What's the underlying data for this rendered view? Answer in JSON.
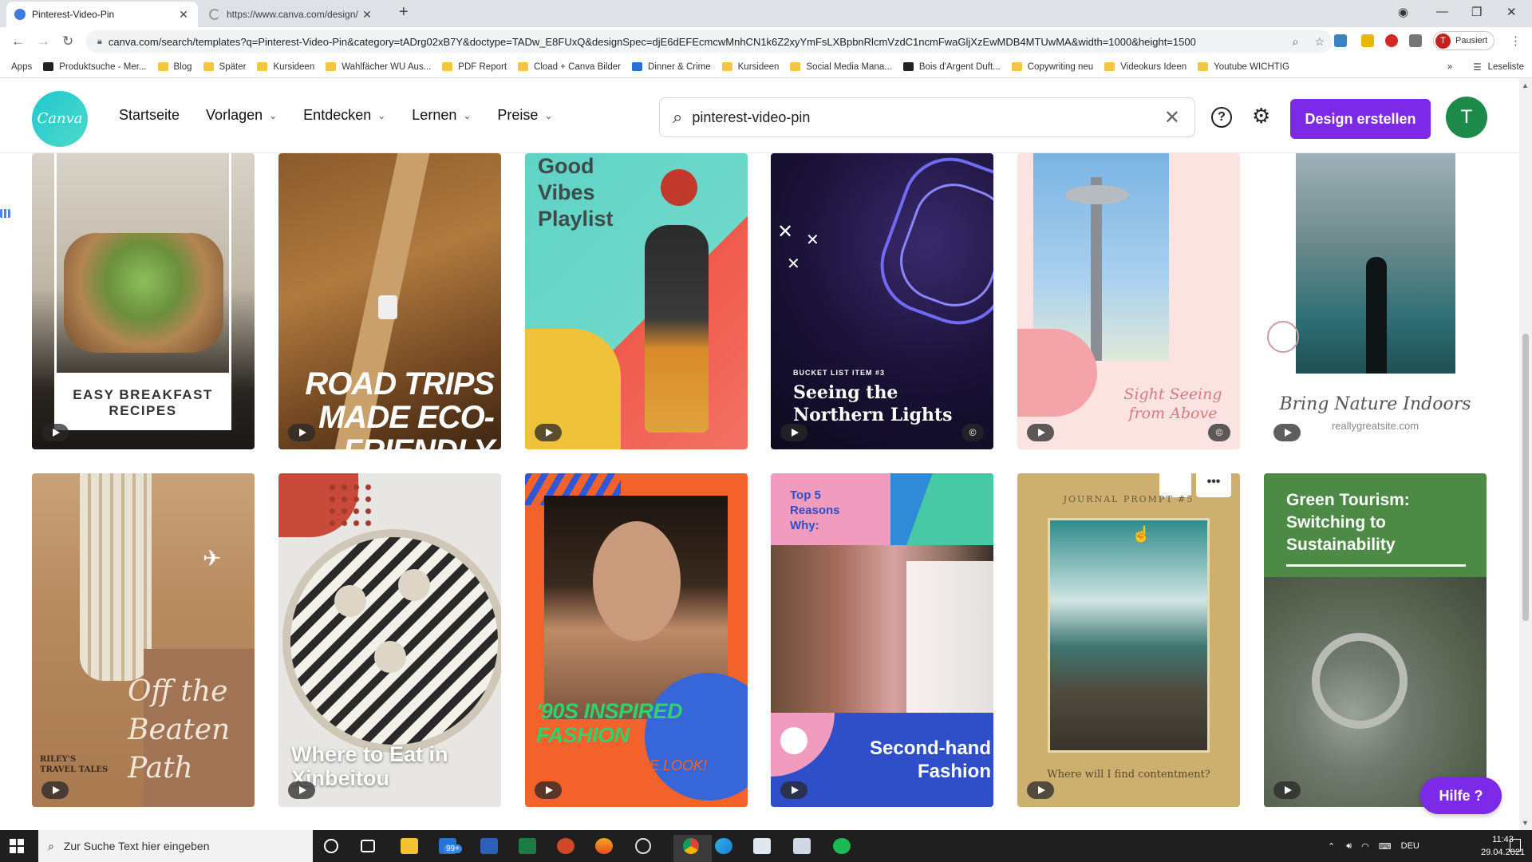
{
  "browser": {
    "tabs": [
      {
        "title": "Pinterest-Video-Pin",
        "active": true
      },
      {
        "title": "https://www.canva.com/design/",
        "active": false
      }
    ],
    "new_tab_icon": "plus-icon",
    "url": "canva.com/search/templates?q=Pinterest-Video-Pin&category=tADrg02xB7Y&doctype=TADw_E8FUxQ&designSpec=djE6dEFEcmcwMnhCN1k6Z2xyYmFsLXBpbnRlcmVzdC1ncmFwaGljXzEwMDB4MTUwMA&width=1000&height=1500",
    "profile_label": "Pausiert",
    "profile_initial": "T",
    "bookmarks": [
      "Apps",
      "Produktsuche - Mer...",
      "Blog",
      "Später",
      "Kursideen",
      "Wahlfächer WU Aus...",
      "PDF Report",
      "Cload + Canva Bilder",
      "Dinner & Crime",
      "Kursideen",
      "Social Media Mana...",
      "Bois d'Argent Duft...",
      "Copywriting neu",
      "Videokurs Ideen",
      "Youtube WICHTIG"
    ],
    "reading_list": "Leseliste",
    "overflow": "»"
  },
  "canva": {
    "logo": "Canva",
    "nav": [
      {
        "label": "Startseite",
        "dropdown": false
      },
      {
        "label": "Vorlagen",
        "dropdown": true
      },
      {
        "label": "Entdecken",
        "dropdown": true
      },
      {
        "label": "Lernen",
        "dropdown": true
      },
      {
        "label": "Preise",
        "dropdown": true
      }
    ],
    "search_value": "pinterest-video-pin",
    "create_button": "Design erstellen",
    "avatar_initial": "T",
    "help_button": "Hilfe ?",
    "accent_color": "#7d2ae8"
  },
  "templates": [
    {
      "caption": "EASY BREAKFAST RECIPES",
      "video": true,
      "premium": false
    },
    {
      "caption": "ROAD TRIPS MADE ECO-FRIENDLY",
      "video": true,
      "premium": false
    },
    {
      "caption": "Good Vibes Playlist",
      "video": true,
      "premium": false
    },
    {
      "kicker": "BUCKET LIST ITEM #3",
      "caption": "Seeing the Northern Lights",
      "video": true,
      "premium": true
    },
    {
      "caption": "Sight Seeing from Above",
      "video": true,
      "premium": true
    },
    {
      "caption": "Bring Nature Indoors",
      "sub": "reallygreatsite.com",
      "video": true,
      "premium": false
    },
    {
      "kicker": "RILEY'S TRAVEL TALES",
      "caption": "Off the Beaten Path",
      "video": true,
      "premium": false
    },
    {
      "caption": "Where to Eat in Xinbeitou",
      "video": true,
      "premium": false
    },
    {
      "caption": "'90S INSPIRED FASHION",
      "sub": "GET THE LOOK!",
      "video": true,
      "premium": false
    },
    {
      "kicker": "Top 5 Reasons Why:",
      "caption": "Second-hand Fashion",
      "video": true,
      "premium": false
    },
    {
      "kicker": "JOURNAL PROMPT #5",
      "caption": "Where will I find contentment?",
      "video": true,
      "premium": false,
      "more_icon": "•••"
    },
    {
      "caption": "Green Tourism: Switching to Sustainability",
      "video": true,
      "premium": false
    }
  ],
  "taskbar": {
    "search_placeholder": "Zur Suche Text hier eingeben",
    "mail_badge": "99+",
    "language": "DEU",
    "time": "11:43",
    "date": "29.04.2021"
  }
}
